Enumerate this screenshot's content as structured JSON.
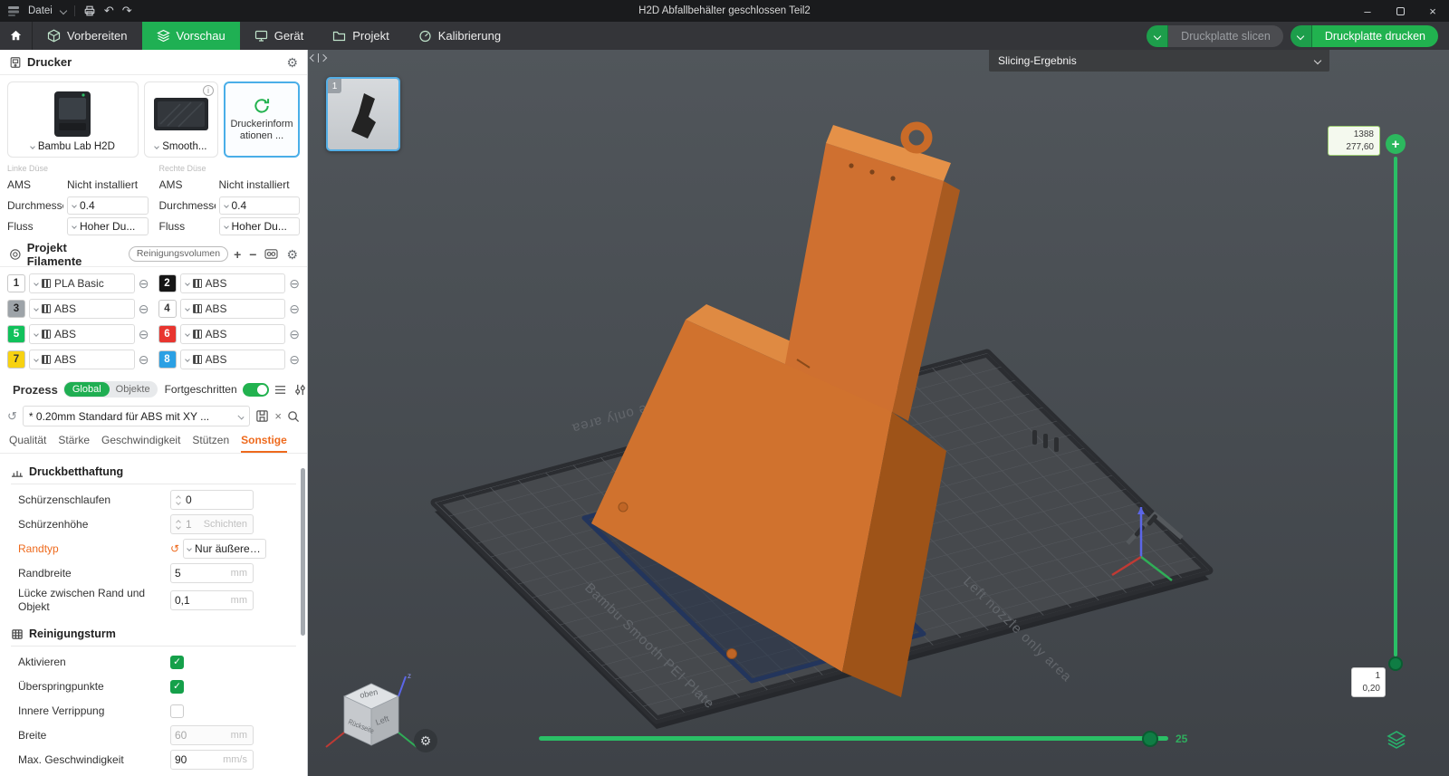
{
  "titlebar": {
    "menu": "Datei",
    "title": "H2D Abfallbehälter geschlossen Teil2"
  },
  "nav": {
    "tabs": [
      {
        "label": "Vorbereiten"
      },
      {
        "label": "Vorschau"
      },
      {
        "label": "Gerät"
      },
      {
        "label": "Projekt"
      },
      {
        "label": "Kalibrierung"
      }
    ],
    "slice_plate": "Druckplatte slicen",
    "print_plate": "Druckplatte drucken"
  },
  "printer": {
    "header": "Drucker",
    "name": "Bambu Lab H2D",
    "plate_type": "Smooth...",
    "info_card": "Druckerinformationen ...",
    "left_nozzle_label": "Linke Düse",
    "right_nozzle_label": "Rechte Düse",
    "ams_label": "AMS",
    "ams_value": "Nicht installiert",
    "diameter_label": "Durchmesser",
    "diameter_value": "0.4",
    "flow_label": "Fluss",
    "flow_value": "Hoher Du..."
  },
  "filaments": {
    "header": "Projekt Filamente",
    "badge": "Reinigungsvolumen",
    "items": [
      {
        "index": "1",
        "name": "PLA Basic",
        "color": "#ffffff",
        "fg": "#333333"
      },
      {
        "index": "2",
        "name": "ABS",
        "color": "#161616",
        "fg": "#ffffff"
      },
      {
        "index": "3",
        "name": "ABS",
        "color": "#9da3a8",
        "fg": "#222222"
      },
      {
        "index": "4",
        "name": "ABS",
        "color": "#ffffff",
        "fg": "#333333"
      },
      {
        "index": "5",
        "name": "ABS",
        "color": "#11c15b",
        "fg": "#ffffff"
      },
      {
        "index": "6",
        "name": "ABS",
        "color": "#e8352f",
        "fg": "#ffffff"
      },
      {
        "index": "7",
        "name": "ABS",
        "color": "#f7d211",
        "fg": "#333333"
      },
      {
        "index": "8",
        "name": "ABS",
        "color": "#2ba0e4",
        "fg": "#ffffff"
      }
    ]
  },
  "process": {
    "label": "Prozess",
    "scope_global": "Global",
    "scope_objects": "Objekte",
    "advanced_label": "Fortgeschritten",
    "advanced_on": true,
    "preset": "* 0.20mm Standard für ABS mit XY ...",
    "tabs": [
      "Qualität",
      "Stärke",
      "Geschwindigkeit",
      "Stützen",
      "Sonstige"
    ]
  },
  "settings": {
    "bed_adhesion": {
      "title": "Druckbetthaftung",
      "skirt_loops": {
        "label": "Schürzenschlaufen",
        "value": "0"
      },
      "skirt_height": {
        "label": "Schürzenhöhe",
        "value": "1",
        "suffix": "Schichten"
      },
      "brim_type": {
        "label": "Randtyp",
        "value": "Nur äußere…"
      },
      "brim_width": {
        "label": "Randbreite",
        "value": "5",
        "unit": "mm"
      },
      "brim_gap": {
        "label": "Lücke zwischen Rand und Objekt",
        "value": "0,1",
        "unit": "mm"
      }
    },
    "prime_tower": {
      "title": "Reinigungsturm",
      "enable": {
        "label": "Aktivieren",
        "checked": true
      },
      "skip_points": {
        "label": "Überspringpunkte",
        "checked": true
      },
      "inner_ribs": {
        "label": "Innere Verrippung",
        "checked": false
      },
      "width": {
        "label": "Breite",
        "value": "60",
        "unit": "mm"
      },
      "max_speed": {
        "label": "Max. Geschwindigkeit",
        "value": "90",
        "unit": "mm/s"
      }
    }
  },
  "viewport": {
    "slicing_result": "Slicing-Ergebnis",
    "plate_thumb_badge": "1",
    "layer_slider": {
      "top_layer": "1388",
      "top_height": "277,60",
      "bottom_layer": "1",
      "bottom_height": "0,20"
    },
    "move_slider": {
      "value": "25"
    },
    "plate": {
      "brand": "Bambu Smooth PEI Plate",
      "right_area": "Right nozzle only area",
      "left_area": "Left nozzle only area"
    },
    "navcube": {
      "top": "oben",
      "back": "Rückseite",
      "left": "Left"
    }
  }
}
